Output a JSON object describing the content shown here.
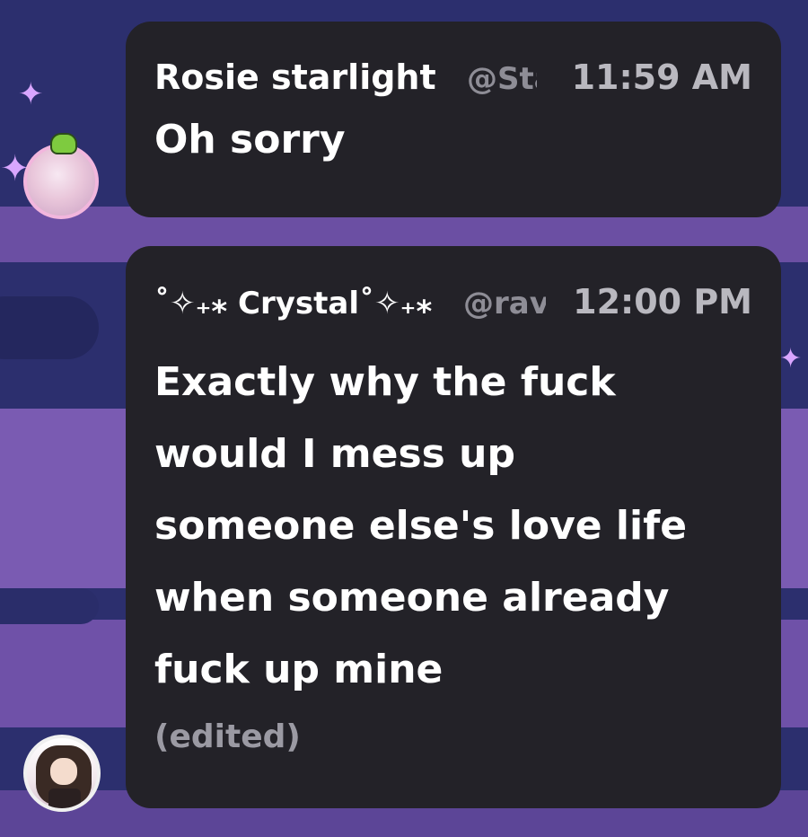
{
  "messages": [
    {
      "author": "Rosie starlight",
      "handle": "@Sta",
      "time": "11:59 AM",
      "lines": [
        "Oh sorry"
      ],
      "avatar_icon": "anime-girl-avatar-icon",
      "badge_icon": "frog-badge-icon",
      "edited": ""
    },
    {
      "author": "˚✧₊⁎ Crystal˚✧₊⁎",
      "handle": "@rav",
      "time": "12:00 PM",
      "lines": [
        "Exactly why the fuck",
        "would I mess up",
        "someone else's love life",
        "when someone already",
        "fuck up mine"
      ],
      "avatar_icon": "anime-girl-avatar-icon",
      "edited": "(edited)"
    }
  ],
  "colors": {
    "bubble": "#232228",
    "background": "#2c2f6e",
    "name": "#ffffff",
    "handle": "#8e8d96",
    "time": "#b9b8bf",
    "edited": "#9b9aa3"
  }
}
